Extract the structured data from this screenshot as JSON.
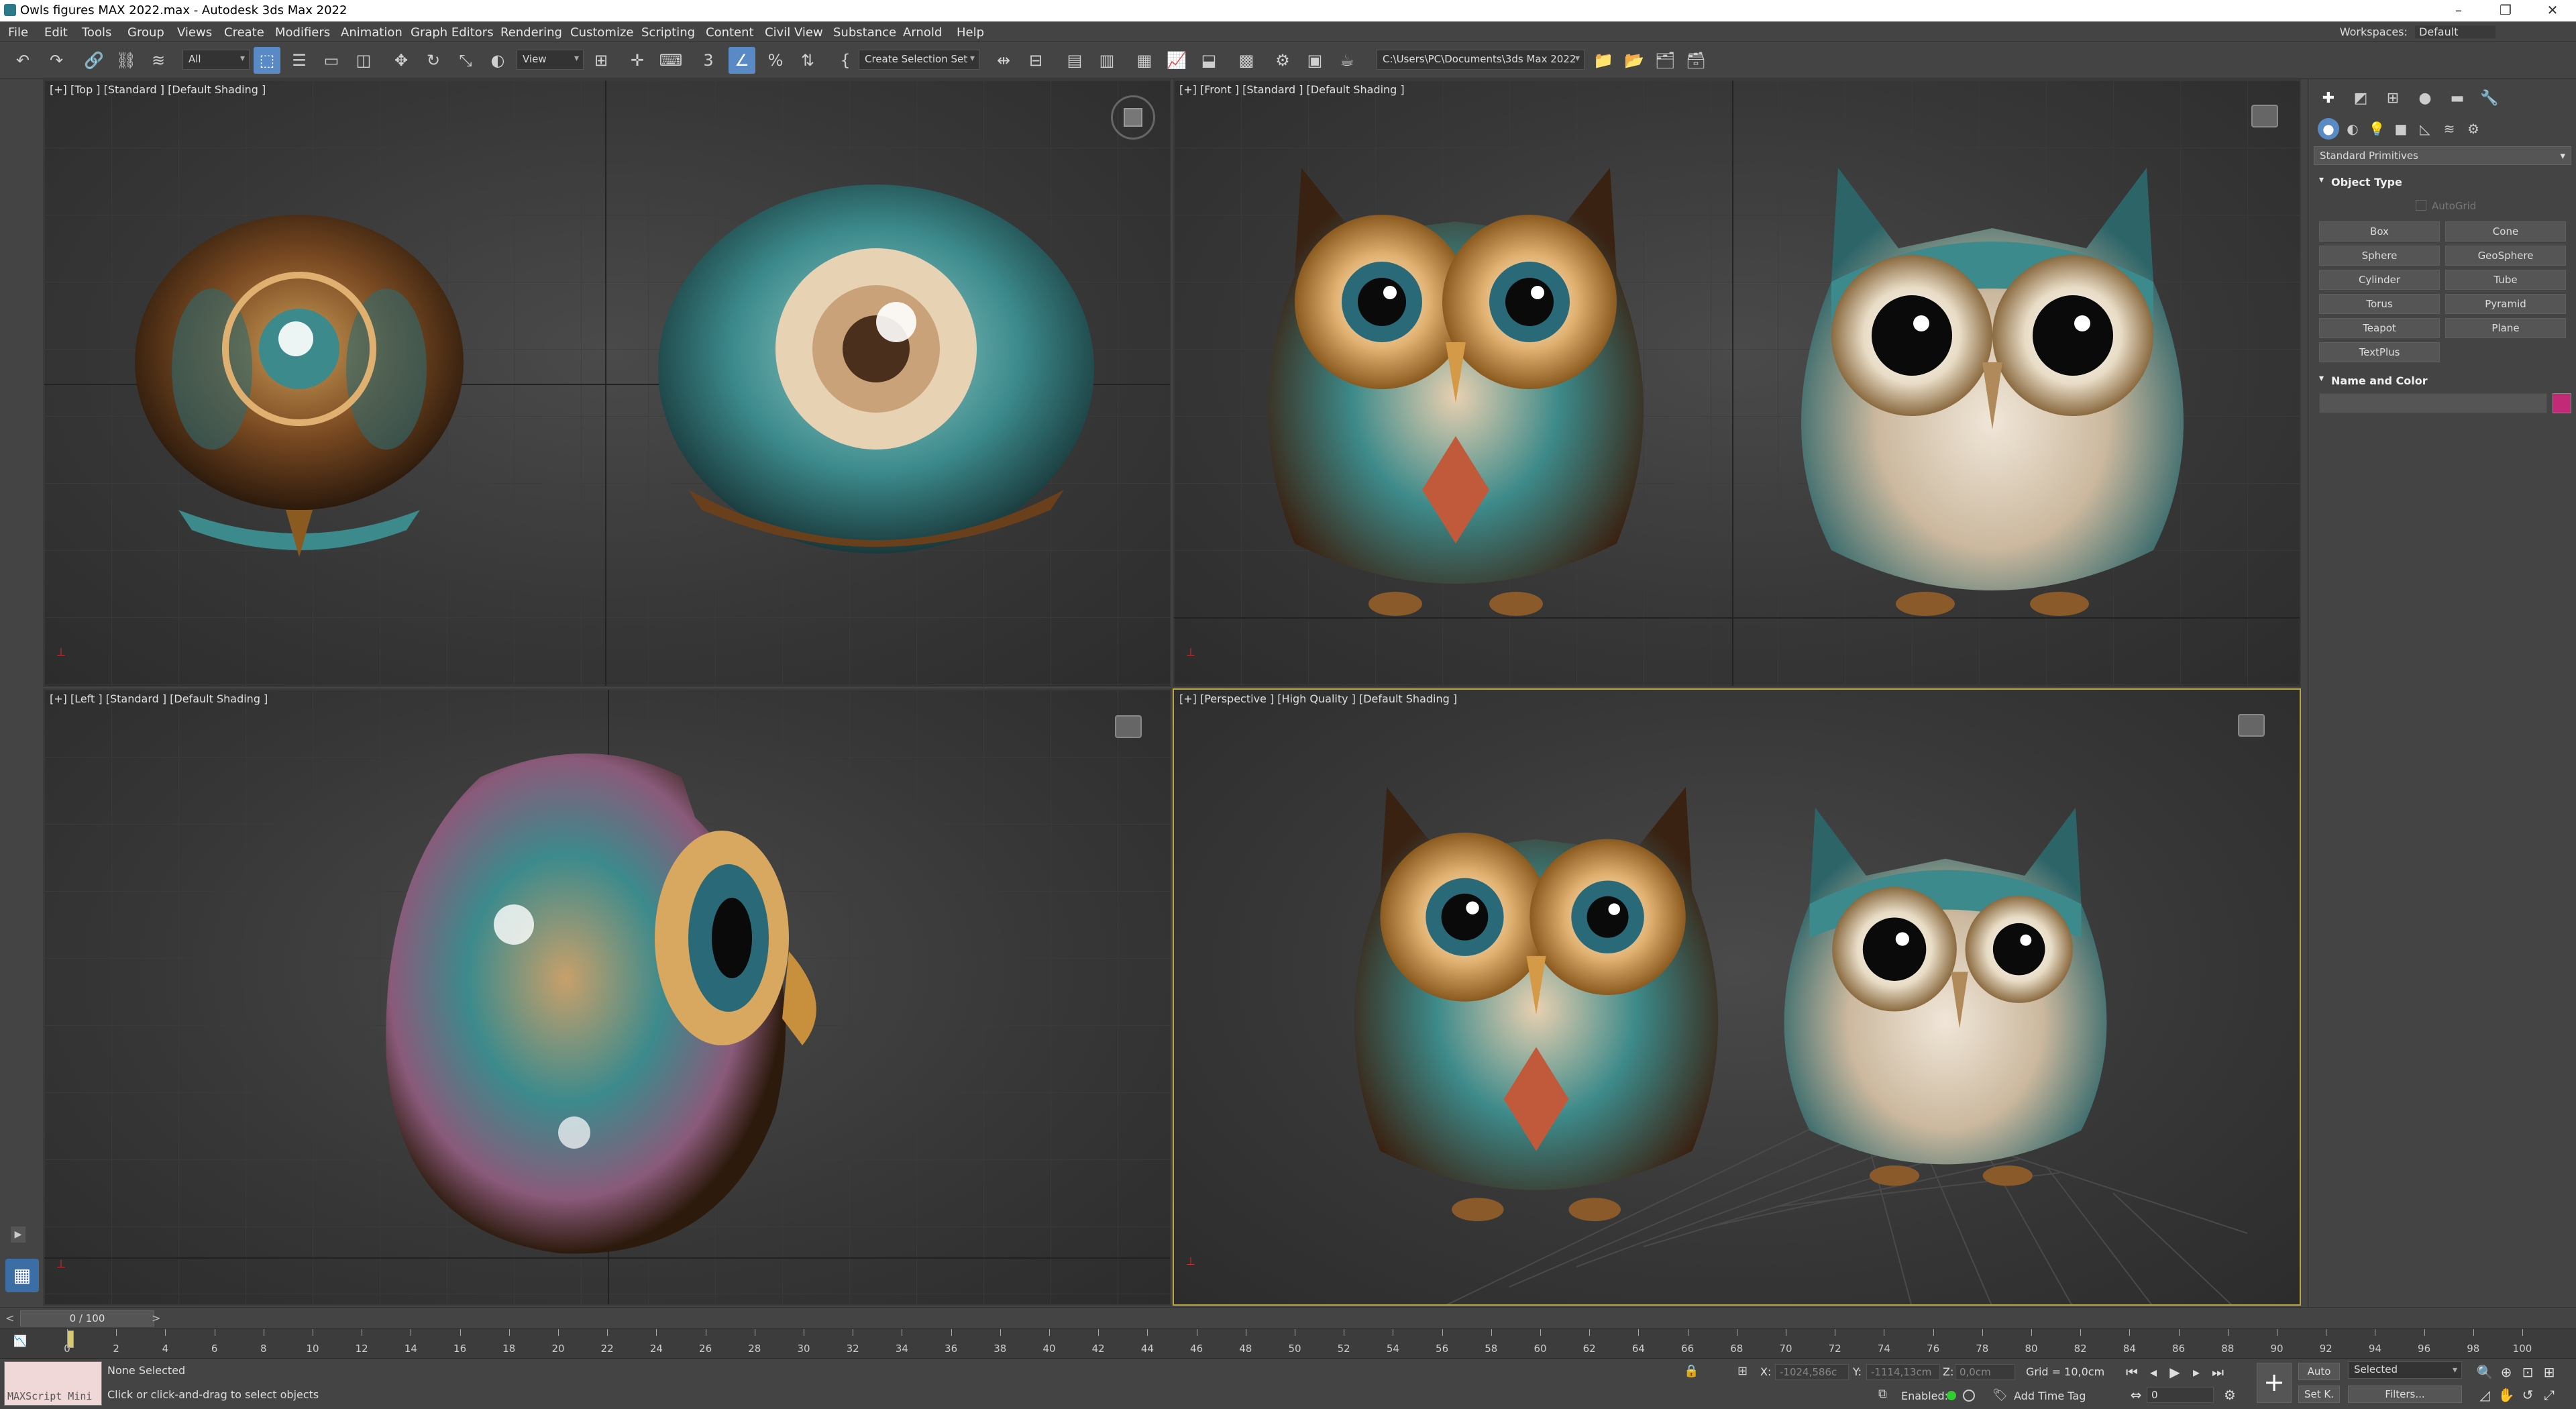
{
  "window": {
    "title": "Owls figures MAX 2022.max - Autodesk 3ds Max 2022",
    "minimize": "–",
    "restore": "❐",
    "close": "✕"
  },
  "menu": {
    "items": [
      "File",
      "Edit",
      "Tools",
      "Group",
      "Views",
      "Create",
      "Modifiers",
      "Animation",
      "Graph Editors",
      "Rendering",
      "Customize",
      "Scripting",
      "Content",
      "Civil View",
      "Substance",
      "Arnold",
      "Help"
    ],
    "workspaces_label": "Workspaces:",
    "workspaces_value": "Default"
  },
  "toolbar": {
    "selection_filter": "All",
    "reference_coord": "View",
    "selection_set": "Create Selection Set",
    "project_path": "C:\\Users\\PC\\Documents\\3ds Max 2022"
  },
  "viewports": {
    "top": "[+] [Top ] [Standard ] [Default Shading ]",
    "front": "[+] [Front ] [Standard ] [Default Shading ]",
    "left": "[+] [Left ] [Standard ] [Default Shading ]",
    "perspective": "[+] [Perspective ] [High Quality ] [Default Shading ]"
  },
  "command_panel": {
    "category": "Standard Primitives",
    "object_type_title": "Object Type",
    "autogrid": "AutoGrid",
    "buttons": [
      "Box",
      "Cone",
      "Sphere",
      "GeoSphere",
      "Cylinder",
      "Tube",
      "Torus",
      "Pyramid",
      "Teapot",
      "Plane",
      "TextPlus"
    ],
    "name_color_title": "Name and Color",
    "object_color": "#c22a78"
  },
  "timeline": {
    "frame_display": "0 / 100",
    "ticks": [
      "0",
      "2",
      "4",
      "6",
      "8",
      "10",
      "12",
      "14",
      "16",
      "18",
      "20",
      "22",
      "24",
      "26",
      "28",
      "30",
      "32",
      "34",
      "36",
      "38",
      "40",
      "42",
      "44",
      "46",
      "48",
      "50",
      "52",
      "54",
      "56",
      "58",
      "60",
      "62",
      "64",
      "66",
      "68",
      "70",
      "72",
      "74",
      "76",
      "78",
      "80",
      "82",
      "84",
      "86",
      "88",
      "90",
      "92",
      "94",
      "96",
      "98",
      "100"
    ]
  },
  "status": {
    "maxscript": "MAXScript Mini",
    "selection": "None Selected",
    "prompt": "Click or click-and-drag to select objects",
    "x_label": "X:",
    "x_value": "-1024,586c",
    "y_label": "Y:",
    "y_value": "-1114,13cm",
    "z_label": "Z:",
    "z_value": "0,0cm",
    "grid": "Grid = 10,0cm",
    "enabled": "Enabled:",
    "add_time_tag": "Add Time Tag",
    "auto": "Auto",
    "selected": "Selected",
    "set_key": "Set K.",
    "filters": "Filters...",
    "current_frame": "0"
  }
}
